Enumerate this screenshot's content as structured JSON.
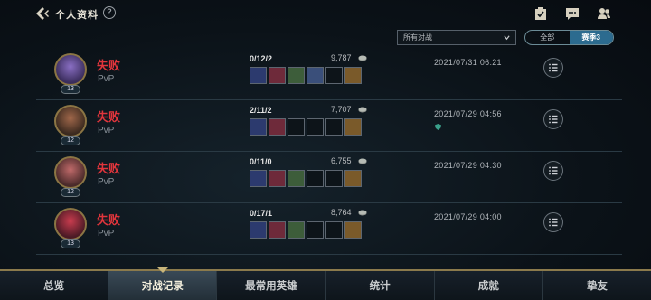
{
  "header": {
    "title": "个人资料",
    "help_glyph": "?"
  },
  "filter": {
    "queue_selected": "所有对战",
    "season_options": [
      "全部",
      "赛季3"
    ],
    "season_active": "赛季3"
  },
  "matches": [
    {
      "result": "失败",
      "mode": "PvP",
      "level": "13",
      "kda": "0/12/2",
      "gold": "9,787",
      "date": "2021/07/31 06:21",
      "items": [
        "item-1",
        "item-2",
        "item-3",
        "item-4",
        "empty",
        "item-5"
      ],
      "has_badge": false
    },
    {
      "result": "失败",
      "mode": "PvP",
      "level": "12",
      "kda": "2/11/2",
      "gold": "7,707",
      "date": "2021/07/29 04:56",
      "items": [
        "item-1",
        "item-2",
        "empty",
        "empty",
        "empty",
        "item-5"
      ],
      "has_badge": true
    },
    {
      "result": "失败",
      "mode": "PvP",
      "level": "12",
      "kda": "0/11/0",
      "gold": "6,755",
      "date": "2021/07/29 04:30",
      "items": [
        "item-1",
        "item-2",
        "item-3",
        "empty",
        "empty",
        "item-5"
      ],
      "has_badge": false
    },
    {
      "result": "失败",
      "mode": "PvP",
      "level": "13",
      "kda": "0/17/1",
      "gold": "8,764",
      "date": "2021/07/29 04:00",
      "items": [
        "item-1",
        "item-2",
        "item-3",
        "empty",
        "empty",
        "item-5"
      ],
      "has_badge": false
    }
  ],
  "tabs": [
    "总览",
    "对战记录",
    "最常用英雄",
    "统计",
    "成就",
    "挚友"
  ],
  "active_tab": "对战记录",
  "colors": {
    "defeat": "#e0353c",
    "accent_gold": "#8b7a4c",
    "season_active": "#2c6b8f"
  },
  "icons": [
    "back-chevron-icon",
    "help-icon",
    "missions-icon",
    "chat-icon",
    "friends-icon",
    "dropdown-chevron-icon",
    "gold-coin-icon",
    "list-detail-icon"
  ]
}
